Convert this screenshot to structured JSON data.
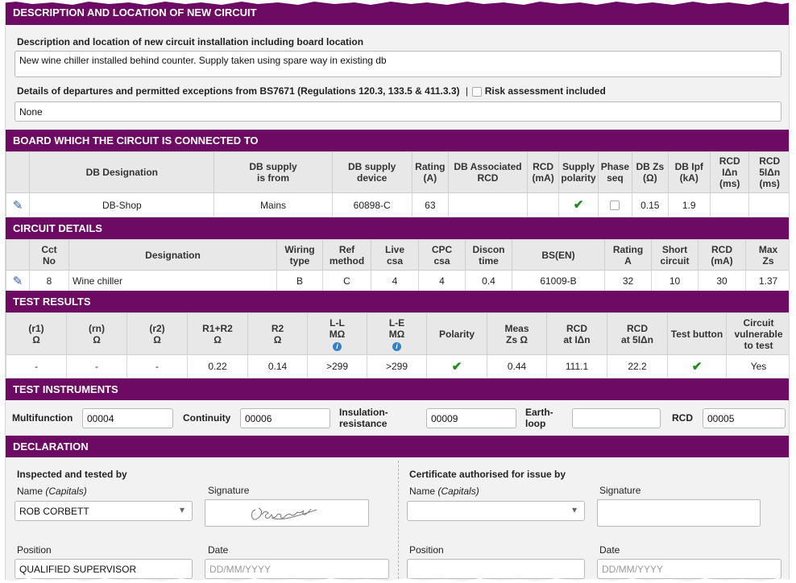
{
  "description": {
    "header": "DESCRIPTION AND LOCATION OF NEW CIRCUIT",
    "install_label": "Description and location of new circuit installation including board location",
    "install_value": "New wine chiller installed behind counter. Supply taken using spare way in existing db",
    "departures_label": "Details of departures and permitted exceptions from BS7671 (Regulations 120.3, 133.5 & 411.3.3)",
    "separator": "|",
    "risk_label": "Risk assessment included",
    "departures_value": "None"
  },
  "board": {
    "header": "BOARD WHICH THE CIRCUIT IS CONNECTED TO",
    "columns": [
      {
        "l1": "",
        "l2": ""
      },
      {
        "l1": "DB Designation",
        "l2": ""
      },
      {
        "l1": "DB supply",
        "l2": "is from"
      },
      {
        "l1": "DB supply",
        "l2": "device"
      },
      {
        "l1": "Rating",
        "l2": "(A)"
      },
      {
        "l1": "DB Associated",
        "l2": "RCD"
      },
      {
        "l1": "RCD",
        "l2": "(mA)"
      },
      {
        "l1": "Supply",
        "l2": "polarity"
      },
      {
        "l1": "Phase",
        "l2": "seq"
      },
      {
        "l1": "DB Zs",
        "l2": "(Ω)"
      },
      {
        "l1": "DB Ipf",
        "l2": "(kA)"
      },
      {
        "l1": "RCD",
        "l2": "IΔn",
        "l3": "(ms)"
      },
      {
        "l1": "RCD",
        "l2": "5IΔn",
        "l3": "(ms)"
      }
    ],
    "row": {
      "designation": "DB-Shop",
      "supply_from": "Mains",
      "supply_device": "60898-C",
      "rating": "63",
      "assoc_rcd": "",
      "rcd_ma": "",
      "db_zs": "0.15",
      "db_ipf": "1.9",
      "rcd_idn": "",
      "rcd_5idn": ""
    }
  },
  "circuit": {
    "header": "CIRCUIT DETAILS",
    "columns": [
      {
        "l1": "",
        "l2": ""
      },
      {
        "l1": "Cct",
        "l2": "No"
      },
      {
        "l1": "Designation",
        "l2": ""
      },
      {
        "l1": "Wiring",
        "l2": "type"
      },
      {
        "l1": "Ref",
        "l2": "method"
      },
      {
        "l1": "Live",
        "l2": "csa"
      },
      {
        "l1": "CPC",
        "l2": "csa"
      },
      {
        "l1": "Discon",
        "l2": "time"
      },
      {
        "l1": "BS(EN)",
        "l2": ""
      },
      {
        "l1": "Rating",
        "l2": "A"
      },
      {
        "l1": "Short",
        "l2": "circuit"
      },
      {
        "l1": "RCD",
        "l2": "(mA)"
      },
      {
        "l1": "Max",
        "l2": "Zs"
      }
    ],
    "row": [
      "8",
      "Wine chiller",
      "B",
      "C",
      "4",
      "4",
      "0.4",
      "61009-B",
      "32",
      "10",
      "30",
      "1.37"
    ]
  },
  "tests": {
    "header": "TEST RESULTS",
    "columns": [
      {
        "l1": "(r1)",
        "l2": "Ω"
      },
      {
        "l1": "(rn)",
        "l2": "Ω"
      },
      {
        "l1": "(r2)",
        "l2": "Ω"
      },
      {
        "l1": "R1+R2",
        "l2": "Ω"
      },
      {
        "l1": "R2",
        "l2": "Ω"
      },
      {
        "l1": "L-L",
        "l2": "MΩ"
      },
      {
        "l1": "L-E",
        "l2": "MΩ"
      },
      {
        "l1": "Polarity",
        "l2": ""
      },
      {
        "l1": "Meas",
        "l2": "Zs Ω"
      },
      {
        "l1": "RCD",
        "l2": "at IΔn"
      },
      {
        "l1": "RCD",
        "l2": "at 5IΔn"
      },
      {
        "l1": "Test button",
        "l2": ""
      },
      {
        "l1": "Circuit",
        "l2": "vulnerable",
        "l3": "to test"
      }
    ],
    "info_icon_text": "i",
    "row": {
      "r1": "-",
      "rn": "-",
      "r2": "-",
      "r1r2": "0.22",
      "R2": "0.14",
      "ll": ">299",
      "le": ">299",
      "meas_zs": "0.44",
      "rcd_idn": "111.1",
      "rcd_5idn": "22.2",
      "vulnerable": "Yes"
    }
  },
  "instruments": {
    "header": "TEST INSTRUMENTS",
    "multifunction_label": "Multifunction",
    "multifunction_value": "00004",
    "continuity_label": "Continuity",
    "continuity_value": "00006",
    "insulation_label_1": "Insulation-",
    "insulation_label_2": "resistance",
    "insulation_value": "00009",
    "earth_label_1": "Earth-",
    "earth_label_2": "loop",
    "earth_value": "",
    "rcd_label": "RCD",
    "rcd_value": "00005"
  },
  "declaration": {
    "header": "DECLARATION",
    "left_title": "Inspected and tested by",
    "right_title": "Certificate authorised for issue by",
    "name_label": "Name",
    "name_hint": "(Capitals)",
    "signature_label": "Signature",
    "position_label": "Position",
    "date_label": "Date",
    "inspector_name": "ROB CORBETT",
    "inspector_position": "QUALIFIED SUPERVISOR",
    "date_placeholder": "DD/MM/YYYY",
    "authoriser_name": "",
    "authoriser_position": ""
  },
  "icons": {
    "edit": "pencil-icon",
    "check": "check-icon",
    "info": "info-icon",
    "dropdown": "chevron-down-icon"
  },
  "colors": {
    "header_bg": "#6d0b64",
    "check_green": "#1f8a1f",
    "info_blue": "#2f82c9"
  }
}
